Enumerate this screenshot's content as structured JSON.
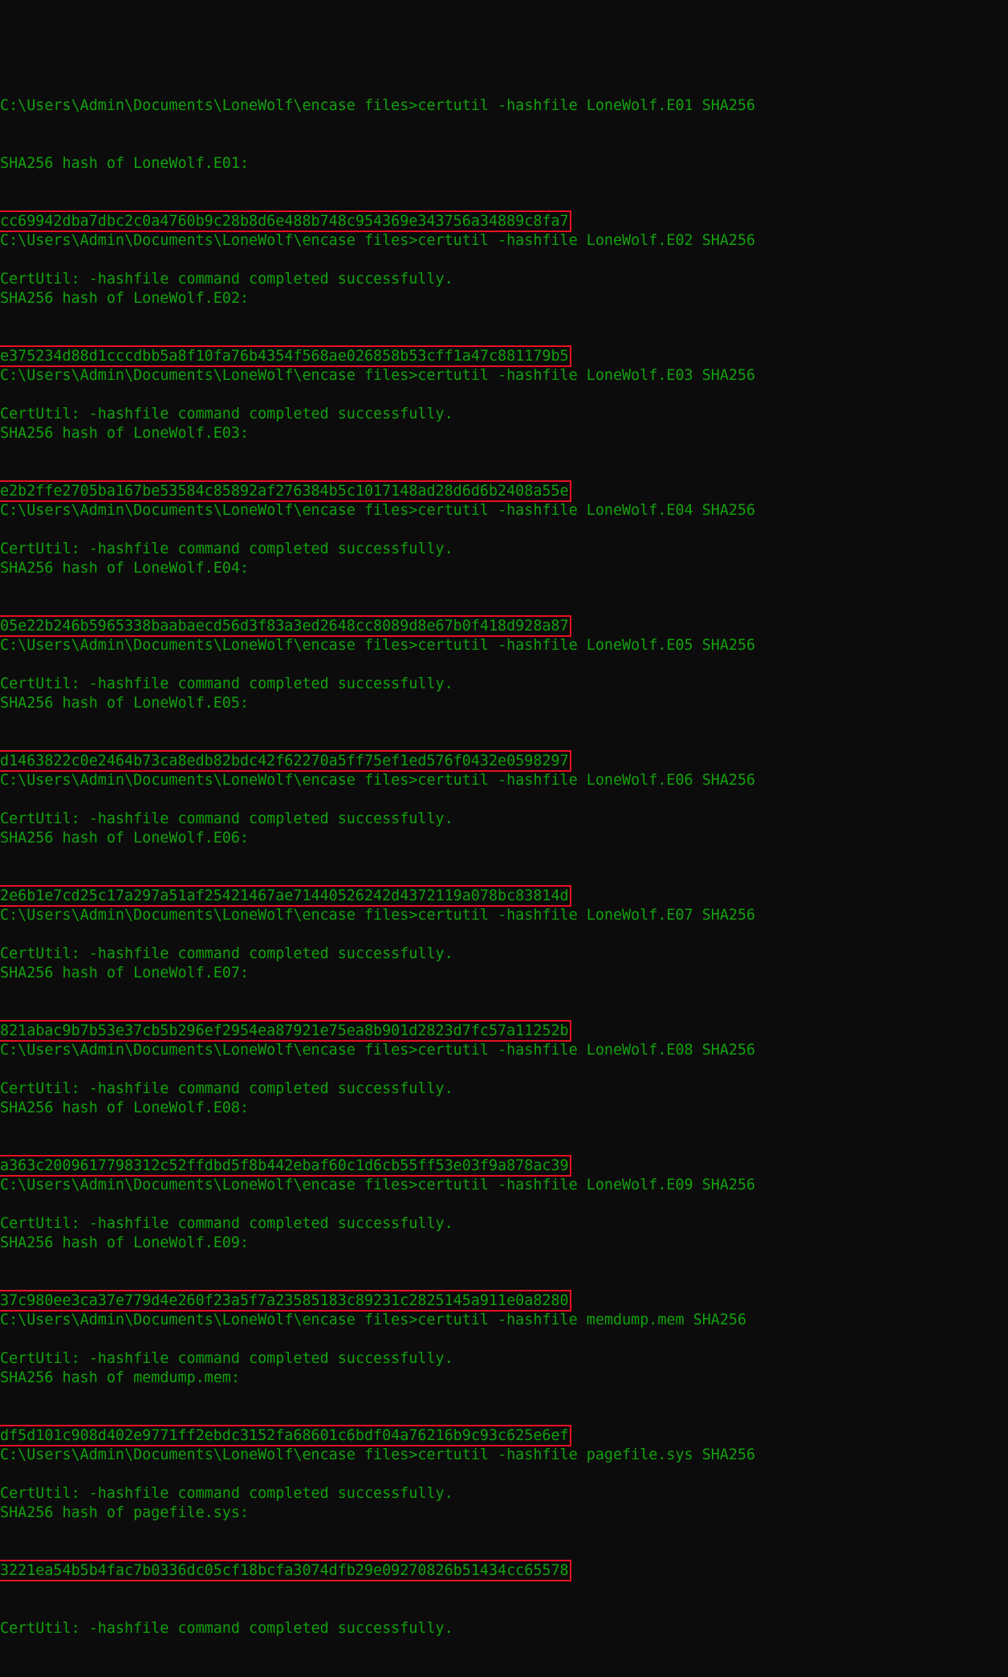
{
  "colors": {
    "background": "#0c0c0c",
    "text": "#13a10e",
    "highlight_box": "#e81123"
  },
  "entries": [
    {
      "command": "C:\\Users\\Admin\\Documents\\LoneWolf\\encase files>certutil -hashfile LoneWolf.E01 SHA256",
      "header": "SHA256 hash of LoneWolf.E01:",
      "hash": "cc69942dba7dbc2c0a4760b9c28b8d6e488b748c954369e343756a34889c8fa7",
      "status": "CertUtil: -hashfile command completed successfully."
    },
    {
      "command": "C:\\Users\\Admin\\Documents\\LoneWolf\\encase files>certutil -hashfile LoneWolf.E02 SHA256",
      "header": "SHA256 hash of LoneWolf.E02:",
      "hash": "e375234d88d1cccdbb5a8f10fa76b4354f568ae026858b53cff1a47c881179b5",
      "status": "CertUtil: -hashfile command completed successfully."
    },
    {
      "command": "C:\\Users\\Admin\\Documents\\LoneWolf\\encase files>certutil -hashfile LoneWolf.E03 SHA256",
      "header": "SHA256 hash of LoneWolf.E03:",
      "hash": "e2b2ffe2705ba167be53584c85892af276384b5c1017148ad28d6d6b2408a55e",
      "status": "CertUtil: -hashfile command completed successfully."
    },
    {
      "command": "C:\\Users\\Admin\\Documents\\LoneWolf\\encase files>certutil -hashfile LoneWolf.E04 SHA256",
      "header": "SHA256 hash of LoneWolf.E04:",
      "hash": "05e22b246b5965338baabaecd56d3f83a3ed2648cc8089d8e67b0f418d928a87",
      "status": "CertUtil: -hashfile command completed successfully."
    },
    {
      "command": "C:\\Users\\Admin\\Documents\\LoneWolf\\encase files>certutil -hashfile LoneWolf.E05 SHA256",
      "header": "SHA256 hash of LoneWolf.E05:",
      "hash": "d1463822c0e2464b73ca8edb82bdc42f62270a5ff75ef1ed576f0432e0598297",
      "status": "CertUtil: -hashfile command completed successfully."
    },
    {
      "command": "C:\\Users\\Admin\\Documents\\LoneWolf\\encase files>certutil -hashfile LoneWolf.E06 SHA256",
      "header": "SHA256 hash of LoneWolf.E06:",
      "hash": "2e6b1e7cd25c17a297a51af25421467ae71440526242d4372119a078bc83814d",
      "status": "CertUtil: -hashfile command completed successfully."
    },
    {
      "command": "C:\\Users\\Admin\\Documents\\LoneWolf\\encase files>certutil -hashfile LoneWolf.E07 SHA256",
      "header": "SHA256 hash of LoneWolf.E07:",
      "hash": "821abac9b7b53e37cb5b296ef2954ea87921e75ea8b901d2823d7fc57a11252b",
      "status": "CertUtil: -hashfile command completed successfully."
    },
    {
      "command": "C:\\Users\\Admin\\Documents\\LoneWolf\\encase files>certutil -hashfile LoneWolf.E08 SHA256",
      "header": "SHA256 hash of LoneWolf.E08:",
      "hash": "a363c2009617798312c52ffdbd5f8b442ebaf60c1d6cb55ff53e03f9a878ac39",
      "status": "CertUtil: -hashfile command completed successfully."
    },
    {
      "command": "C:\\Users\\Admin\\Documents\\LoneWolf\\encase files>certutil -hashfile LoneWolf.E09 SHA256",
      "header": "SHA256 hash of LoneWolf.E09:",
      "hash": "37c980ee3ca37e779d4e260f23a5f7a23585183c89231c2825145a911e0a8280",
      "status": "CertUtil: -hashfile command completed successfully."
    },
    {
      "command": "C:\\Users\\Admin\\Documents\\LoneWolf\\encase files>certutil -hashfile memdump.mem SHA256",
      "header": "SHA256 hash of memdump.mem:",
      "hash": "df5d101c908d402e9771ff2ebdc3152fa68601c6bdf04a76216b9c93c625e6ef",
      "status": "CertUtil: -hashfile command completed successfully."
    },
    {
      "command": "C:\\Users\\Admin\\Documents\\LoneWolf\\encase files>certutil -hashfile pagefile.sys SHA256",
      "header": "SHA256 hash of pagefile.sys:",
      "hash": "3221ea54b5b4fac7b0336dc05cf18bcfa3074dfb29e09270826b51434cc65578",
      "status": "CertUtil: -hashfile command completed successfully."
    }
  ]
}
